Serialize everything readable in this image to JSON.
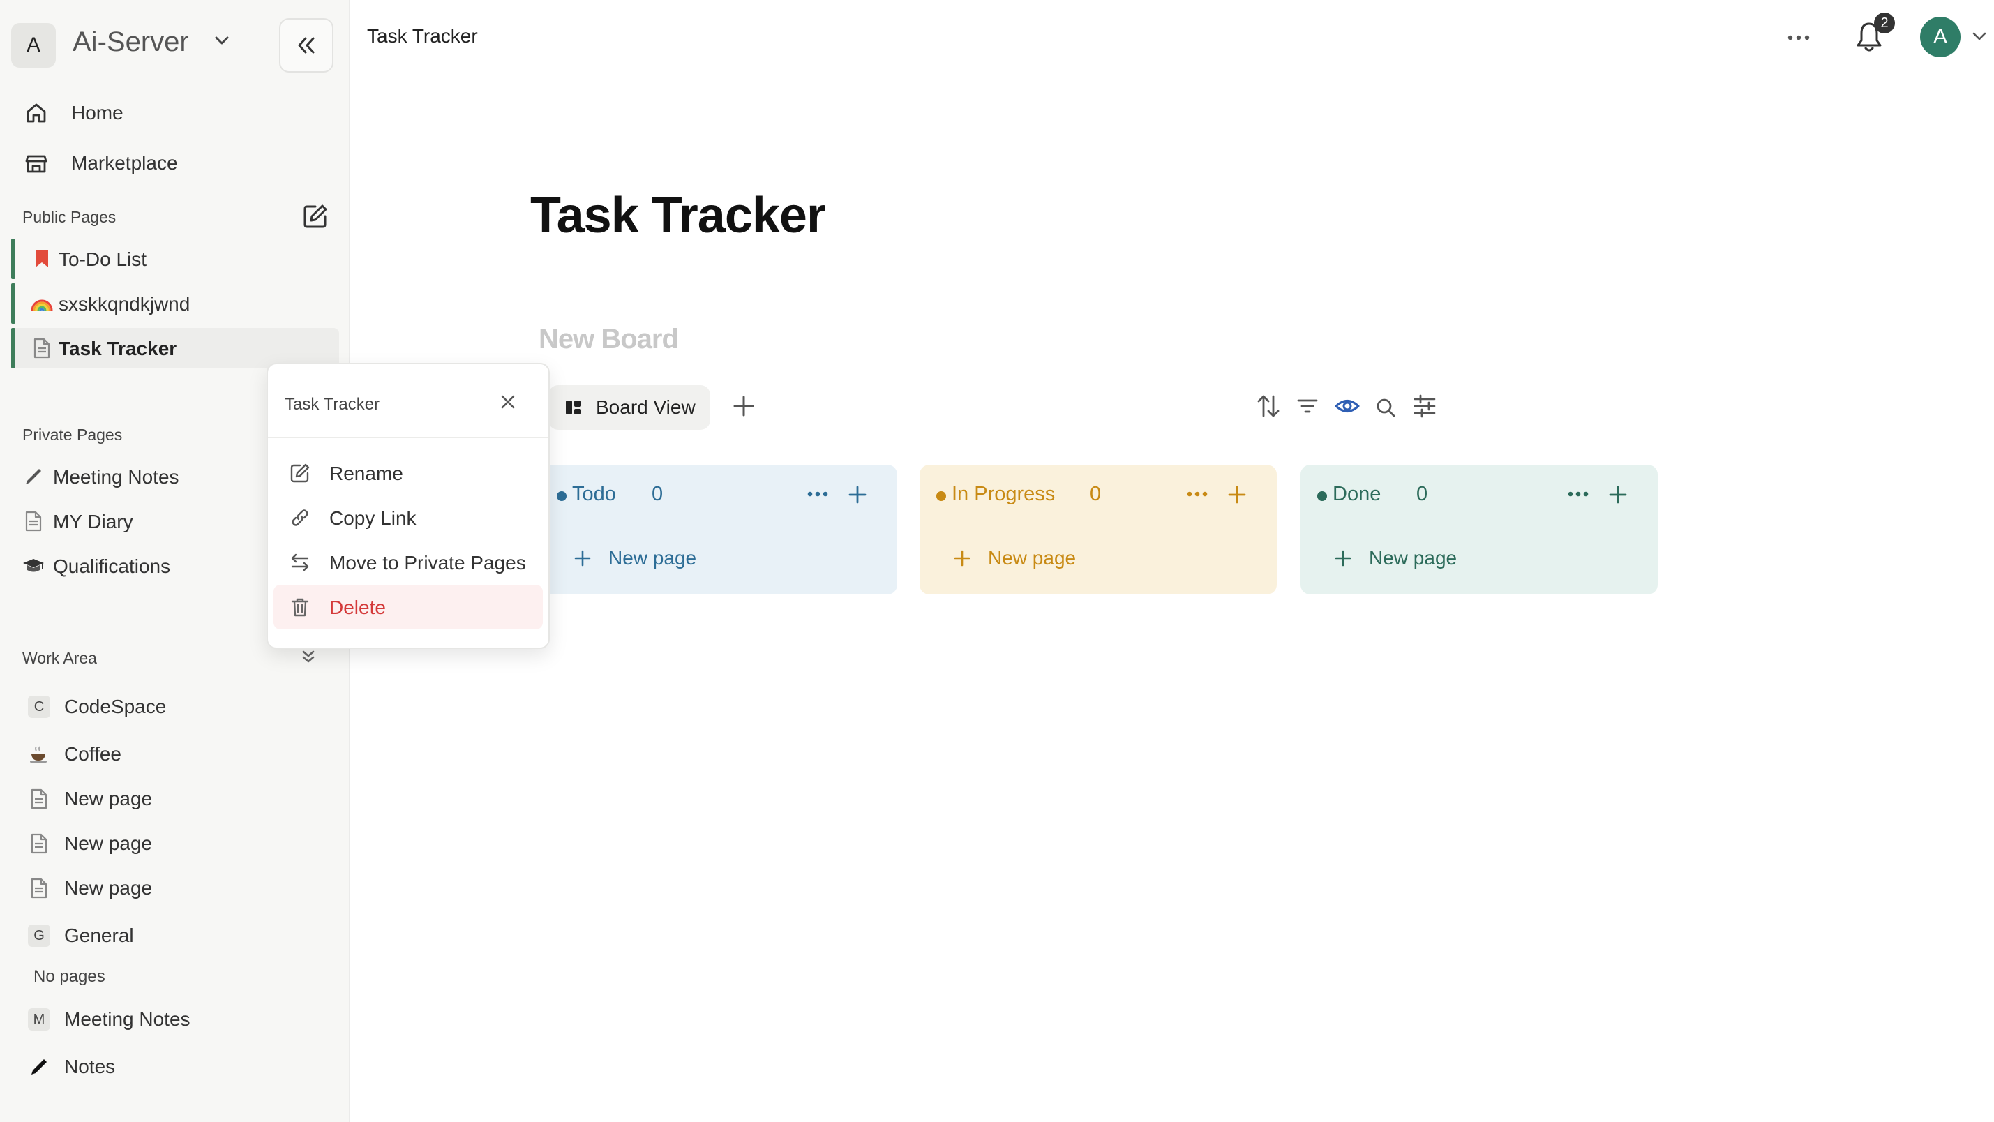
{
  "workspace": {
    "initial": "A",
    "name": "Ai-Server"
  },
  "nav": [
    {
      "label": "Home",
      "icon": "home-icon"
    },
    {
      "label": "Marketplace",
      "icon": "store-icon"
    }
  ],
  "public_pages": {
    "title": "Public Pages",
    "items": [
      {
        "label": "To-Do List",
        "icon": "bookmark-icon"
      },
      {
        "label": "sxskkqndkjwnd",
        "icon": "rainbow-icon"
      },
      {
        "label": "Task Tracker",
        "icon": "document-icon",
        "active": true
      }
    ]
  },
  "private_pages": {
    "title": "Private Pages",
    "items": [
      {
        "label": "Meeting Notes",
        "icon": "pen-icon"
      },
      {
        "label": "MY Diary",
        "icon": "document-icon"
      },
      {
        "label": "Qualifications",
        "icon": "graduation-cap-icon"
      }
    ]
  },
  "work_area": {
    "title": "Work Area",
    "spaces": [
      {
        "initial": "C",
        "label": "CodeSpace",
        "pages": [
          "Coffee",
          "New page",
          "New page",
          "New page"
        ]
      },
      {
        "initial": "G",
        "label": "General",
        "empty_text": "No pages"
      },
      {
        "initial": "M",
        "label": "Meeting Notes",
        "pages": [
          "Notes"
        ]
      }
    ]
  },
  "topbar": {
    "title": "Task Tracker",
    "notification_count": "2",
    "avatar_initial": "A"
  },
  "main": {
    "title": "Task Tracker",
    "board_name": "New Board",
    "view_tab": "Board View",
    "columns": [
      {
        "name": "Todo",
        "count": "0",
        "new_label": "New page",
        "bg": "#e8f1f7",
        "accent": "#2d6d96"
      },
      {
        "name": "In Progress",
        "count": "0",
        "new_label": "New page",
        "bg": "#faf1dc",
        "accent": "#c88a14"
      },
      {
        "name": "Done",
        "count": "0",
        "new_label": "New page",
        "bg": "#e6f2ef",
        "accent": "#2c6b5a"
      }
    ]
  },
  "context_menu": {
    "title": "Task Tracker",
    "items": [
      {
        "label": "Rename",
        "icon": "edit-icon"
      },
      {
        "label": "Copy Link",
        "icon": "link-icon"
      },
      {
        "label": "Move to Private Pages",
        "icon": "swap-icon"
      },
      {
        "label": "Delete",
        "icon": "trash-icon",
        "danger": true
      }
    ]
  },
  "colors": {
    "accent_green": "#3e7d5a",
    "danger": "#d43a3a",
    "eye_blue": "#2f5fb4"
  }
}
